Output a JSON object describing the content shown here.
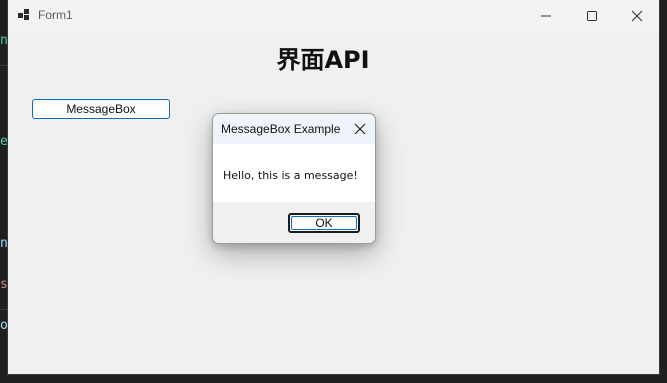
{
  "background_editor": {
    "edge_chars": [
      {
        "char": "n",
        "color": "#4ec9b0"
      },
      {
        "char": "e",
        "color": "#4ec9b0"
      },
      {
        "char": "n",
        "color": "#9cdcfe"
      },
      {
        "char": "s",
        "color": "#ce9178"
      },
      {
        "char": "o",
        "color": "#9cdcfe"
      }
    ]
  },
  "window": {
    "title": "Form1",
    "controls": [
      "minimize-icon",
      "maximize-icon",
      "close-icon"
    ]
  },
  "main": {
    "heading": "界面API",
    "messagebox_button_label": "MessageBox"
  },
  "dialog": {
    "title": "MessageBox Example",
    "message": "Hello, this is a message!",
    "ok_label": "OK"
  },
  "colors": {
    "accent": "#0f6cbd",
    "dialog_titlebar": "#eef4f9",
    "window_bg": "#f0f0f0"
  }
}
